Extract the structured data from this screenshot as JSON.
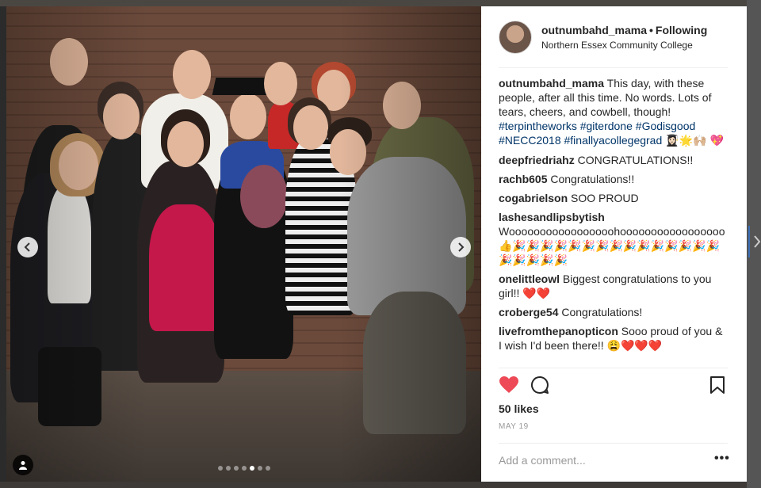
{
  "post": {
    "username": "outnumbahd_mama",
    "follow_status": "Following",
    "separator": "•",
    "location": "Northern Essex Community College",
    "caption": {
      "text": "This day, with these people, after all this time. No words. Lots of tears, cheers, and cowbell, though!",
      "hashtags": [
        "#terpintheworks",
        "#giterdone",
        "#Godisgood",
        "#NECC2018",
        "#finallyacollegegrad"
      ],
      "trailing_emoji": "👩🏻‍🎓🌟🙌🏼 💖"
    },
    "comments": [
      {
        "user": "deepfriedriahz",
        "text": "CONGRATULATIONS!!"
      },
      {
        "user": "rachb605",
        "text": "Congratulations!!"
      },
      {
        "user": "cogabrielson",
        "text": "SOO PROUD"
      },
      {
        "user": "lashesandlipsbytish",
        "text": "Wooooooooooooooooohooooooooooooooooo👍🎉🎉🎉🎉🎉🎉🎉🎉🎉🎉🎉🎉🎉🎉🎉🎉🎉🎉🎉🎉"
      },
      {
        "user": "onelittleowl",
        "text": "Biggest congratulations to you girl!! ❤️❤️"
      },
      {
        "user": "croberge54",
        "text": "Congratulations!"
      },
      {
        "user": "livefromthepanopticon",
        "text": "Sooo proud of you & I wish I'd been there!! 😩❤️❤️❤️"
      }
    ],
    "likes": "50 likes",
    "date": "MAY 19",
    "add_comment_placeholder": "Add a comment..."
  },
  "carousel": {
    "dot_count": 7,
    "active_index": 4
  },
  "colors": {
    "like_red": "#ed4956",
    "hashtag_blue": "#003569",
    "text": "#262626",
    "muted": "#999999"
  },
  "icons": {
    "like": "heart-icon",
    "comment": "comment-icon",
    "save": "bookmark-icon",
    "prev": "chevron-left-icon",
    "next": "chevron-right-icon",
    "tag": "person-tag-icon"
  }
}
